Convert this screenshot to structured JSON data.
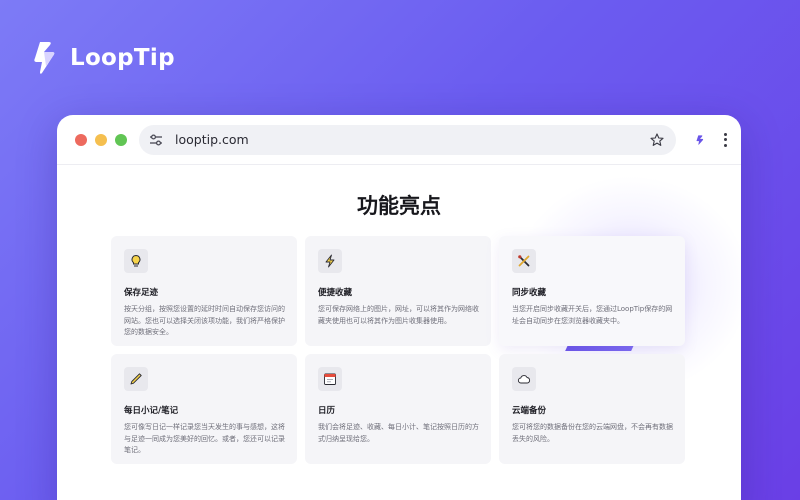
{
  "brand": {
    "name": "LoopTip"
  },
  "browser": {
    "url": "looptip.com",
    "controls": {
      "close": "close",
      "minimize": "minimize",
      "maximize": "maximize"
    },
    "icons": {
      "tune": "tune-icon",
      "star": "bookmark-star-icon",
      "extension": "looptip-extension-icon",
      "menu": "more-vert-icon"
    }
  },
  "page": {
    "title": "功能亮点",
    "features": [
      {
        "icon": "lightbulb-icon",
        "title": "保存足迹",
        "desc": "按天分组，按照您设置的延时时间自动保存您访问的网站。您也可以选择关闭该项功能，我们将严格保护您的数据安全。"
      },
      {
        "icon": "lightning-icon",
        "title": "便捷收藏",
        "desc": "您可保存网络上的图片，网址，可以将其作为网络收藏夹使用也可以将其作为图片收集器使用。"
      },
      {
        "icon": "tools-icon",
        "title": "同步收藏",
        "desc": "当您开启同步收藏开关后，您通过LoopTip保存的网址会自动同步在您浏览器收藏夹中。"
      },
      {
        "icon": "pencil-icon",
        "title": "每日小记/笔记",
        "desc": "您可像写日记一样记录您当天发生的事与感想，这将与足迹一同成为您美好的回忆。或者，您还可以记录笔记。"
      },
      {
        "icon": "calendar-icon",
        "title": "日历",
        "desc": "我们会将足迹、收藏、每日小计、笔记按照日历的方式归纳呈现给您。"
      },
      {
        "icon": "cloud-icon",
        "title": "云端备份",
        "desc": "您可将您的数据备份在您的云端网盘，不会再有数据丢失的风险。"
      }
    ]
  },
  "colors": {
    "background": "#6b5cf0",
    "accent": "#6a55e8",
    "card": "#f5f5f8"
  }
}
